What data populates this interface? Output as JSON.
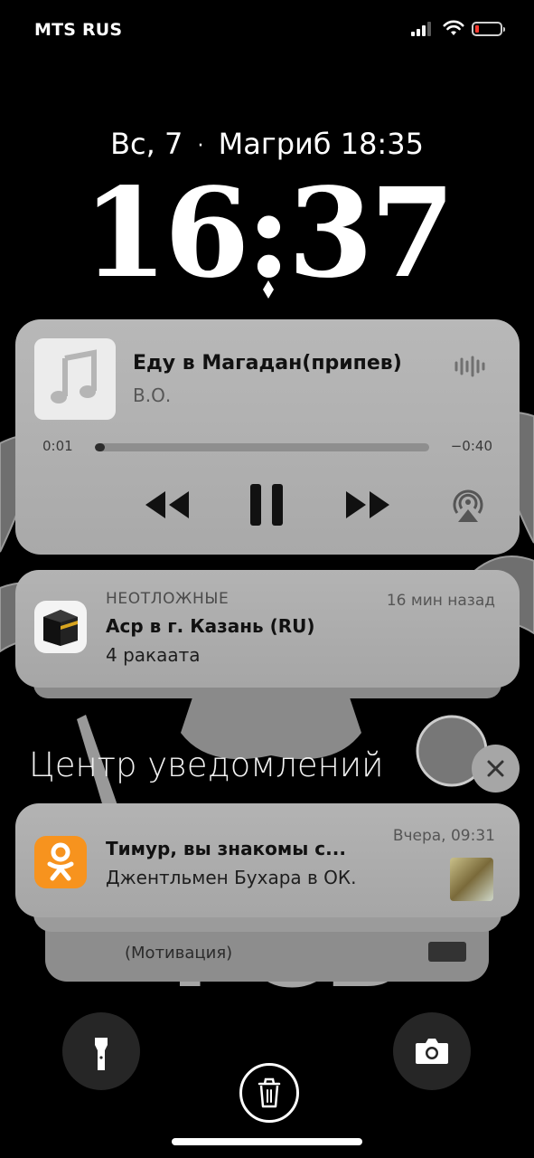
{
  "status_bar": {
    "carrier": "MTS RUS",
    "battery_color": "#ff3b30"
  },
  "lock": {
    "date": "Вс, 7",
    "separator": "·",
    "prayer": "Магриб 18:35",
    "time": "16:37"
  },
  "wallpaper": {
    "text": "ФСБ"
  },
  "player": {
    "title": "Еду в Магадан(припев)",
    "artist": "В.О.",
    "elapsed": "0:01",
    "remaining": "−0:40",
    "progress_fraction": 0.03,
    "controls": [
      "rewind-icon",
      "pause-icon",
      "fast-forward-icon",
      "airplay-icon"
    ]
  },
  "notifications": [
    {
      "app": "НЕОТЛОЖНЫЕ",
      "time": "16 мин назад",
      "title": "Аср в г. Казань (RU)",
      "body": "4 ракаата",
      "icon": "kaaba-icon"
    }
  ],
  "notification_center": {
    "title": "Центр уведомлений",
    "items": [
      {
        "time": "Вчера, 09:31",
        "title": "Тимур, вы знакомы с...",
        "body": "Джентльмен Бухара в ОК.",
        "icon": "odnoklassniki-icon",
        "accent": "#f7931e"
      }
    ],
    "stacked_hint": "(Мотивация)"
  }
}
